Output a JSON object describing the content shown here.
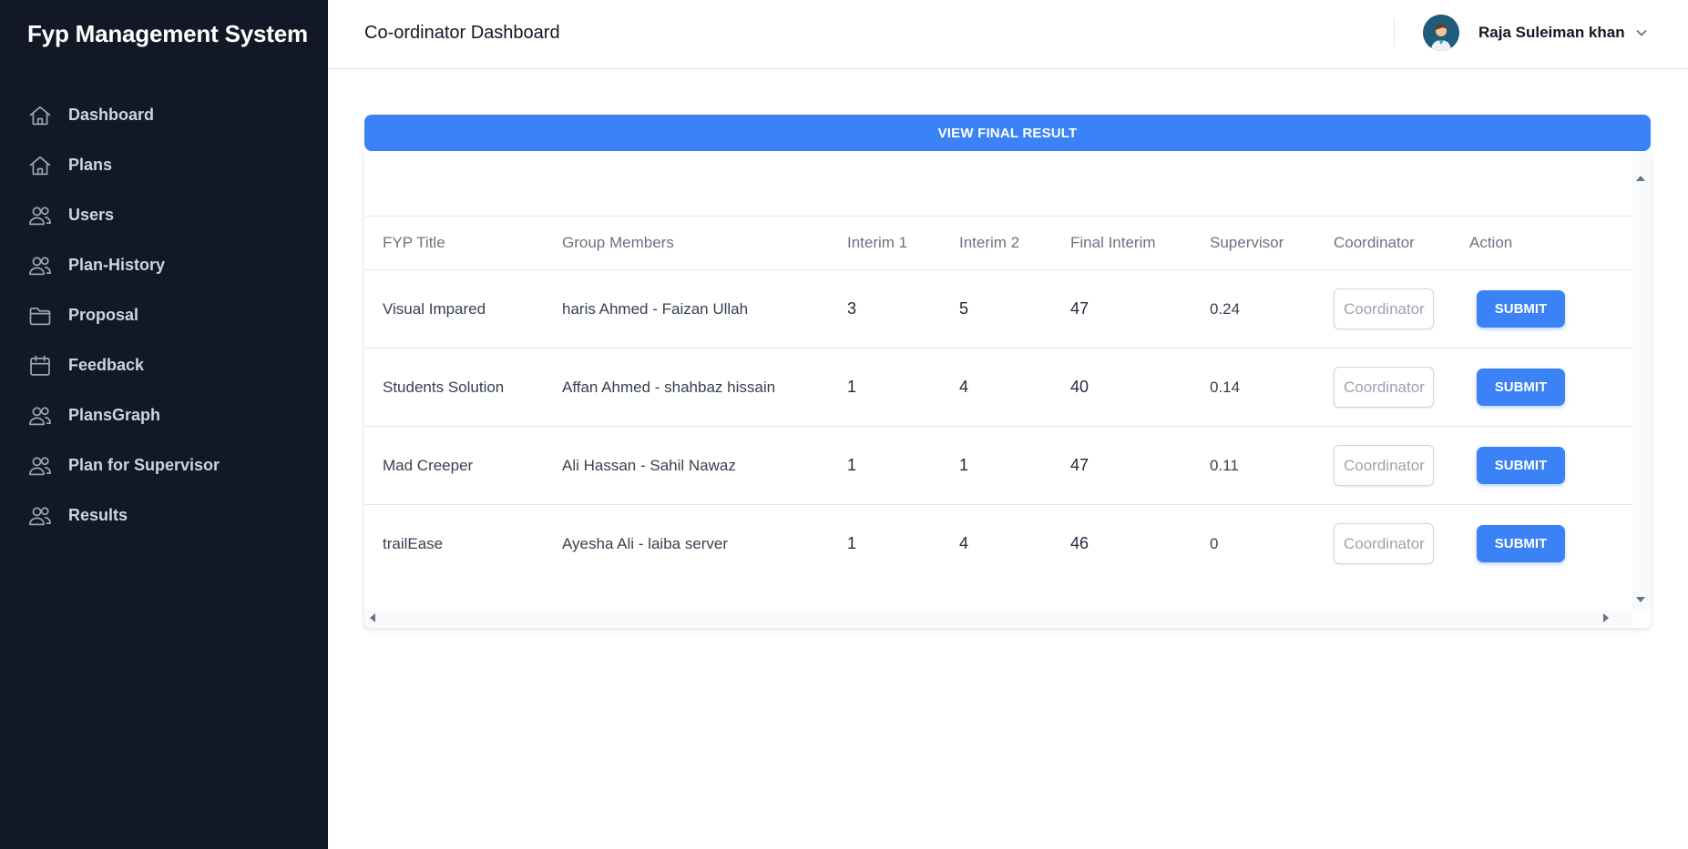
{
  "app": {
    "brand": "Fyp Management System"
  },
  "sidebar": {
    "items": [
      {
        "label": "Dashboard",
        "icon": "home-icon"
      },
      {
        "label": "Plans",
        "icon": "home-icon"
      },
      {
        "label": "Users",
        "icon": "users-icon"
      },
      {
        "label": "Plan-History",
        "icon": "users-icon"
      },
      {
        "label": "Proposal",
        "icon": "folder-icon"
      },
      {
        "label": "Feedback",
        "icon": "calendar-icon"
      },
      {
        "label": "PlansGraph",
        "icon": "users-icon"
      },
      {
        "label": "Plan for Supervisor",
        "icon": "users-icon"
      },
      {
        "label": "Results",
        "icon": "users-icon"
      }
    ]
  },
  "header": {
    "title": "Co-ordinator Dashboard",
    "user_name": "Raja Suleiman khan",
    "avatar_icon": "user-avatar-icon"
  },
  "main": {
    "final_result_label": "VIEW FINAL RESULT",
    "table": {
      "columns": [
        "FYP Title",
        "Group Members",
        "Interim 1",
        "Interim 2",
        "Final Interim",
        "Supervisor",
        "Coordinator",
        "Action"
      ],
      "rows": [
        {
          "title": "Visual Impared",
          "members": "haris Ahmed - Faizan Ullah",
          "interim1": "3",
          "interim2": "5",
          "final_interim": "47",
          "supervisor": "0.24",
          "coordinator_placeholder": "Coordinator",
          "action": "SUBMIT"
        },
        {
          "title": "Students Solution",
          "members": "Affan Ahmed - shahbaz hissain",
          "interim1": "1",
          "interim2": "4",
          "final_interim": "40",
          "supervisor": "0.14",
          "coordinator_placeholder": "Coordinator",
          "action": "SUBMIT"
        },
        {
          "title": "Mad Creeper",
          "members": "Ali Hassan - Sahil Nawaz",
          "interim1": "1",
          "interim2": "1",
          "final_interim": "47",
          "supervisor": "0.11",
          "coordinator_placeholder": "Coordinator",
          "action": "SUBMIT"
        },
        {
          "title": "trailEase",
          "members": "Ayesha Ali - laiba server",
          "interim1": "1",
          "interim2": "4",
          "final_interim": "46",
          "supervisor": "0",
          "coordinator_placeholder": "Coordinator",
          "action": "SUBMIT"
        }
      ]
    }
  },
  "colors": {
    "sidebar_bg": "#121826",
    "accent": "#3b82f6"
  }
}
